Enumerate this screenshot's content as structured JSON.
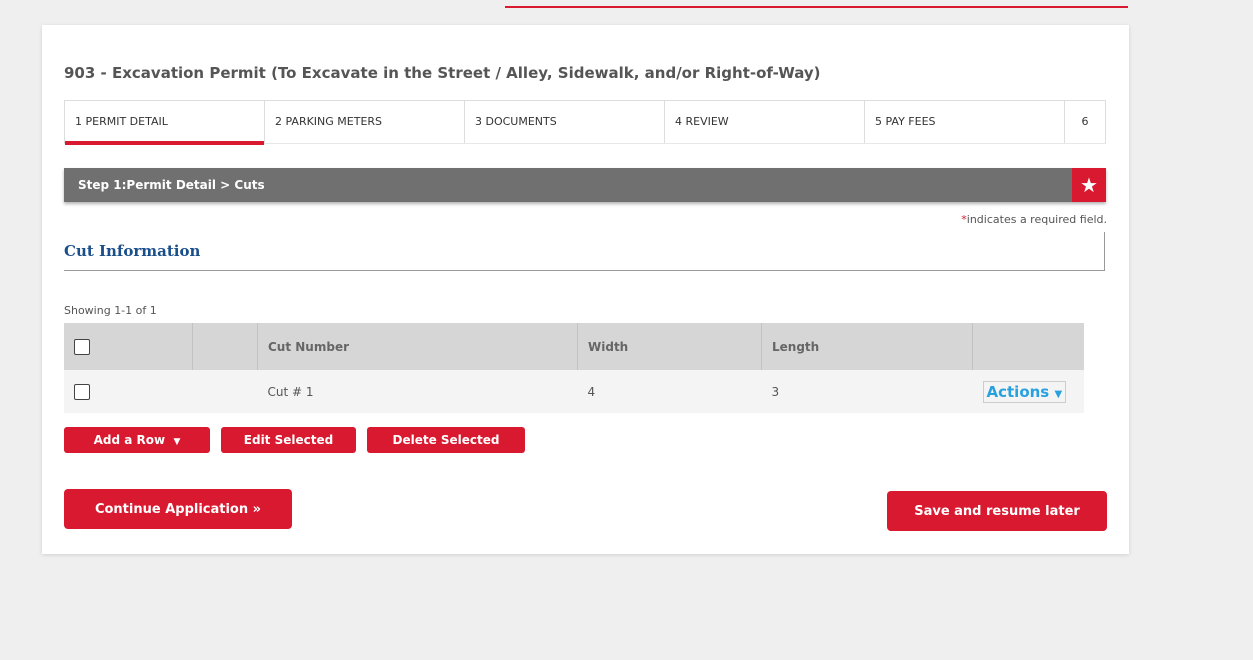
{
  "page": {
    "title": "903 - Excavation Permit (To Excavate in the Street / Alley, Sidewalk, and/or Right-of-Way)"
  },
  "tabs": [
    {
      "label": "1 PERMIT DETAIL",
      "active": true
    },
    {
      "label": "2 PARKING METERS",
      "active": false
    },
    {
      "label": "3 DOCUMENTS",
      "active": false
    },
    {
      "label": "4 REVIEW",
      "active": false
    },
    {
      "label": "5 PAY FEES",
      "active": false
    },
    {
      "label": "6",
      "active": false
    }
  ],
  "step_bar": {
    "title": "Step 1:Permit Detail > Cuts",
    "star_glyph": "★"
  },
  "required_note": {
    "asterisk": "*",
    "text": "indicates a required field."
  },
  "section": {
    "title": "Cut Information"
  },
  "table": {
    "showing": "Showing 1-1 of 1",
    "headers": [
      "",
      "",
      "Cut Number",
      "Width",
      "Length",
      ""
    ],
    "rows": [
      {
        "cut_number": "Cut # 1",
        "width": "4",
        "length": "3",
        "actions_label": "Actions"
      }
    ]
  },
  "buttons": {
    "add_row": "Add a Row",
    "edit_selected": "Edit Selected",
    "delete_selected": "Delete Selected",
    "continue": "Continue Application »",
    "save_resume": "Save and resume later"
  },
  "icons": {
    "star": "star-icon",
    "caret_down": "caret-down-icon"
  },
  "colors": {
    "accent": "#d9192f",
    "section_title": "#1a4f8c",
    "link": "#27a1e0",
    "step_bar": "#707070"
  }
}
